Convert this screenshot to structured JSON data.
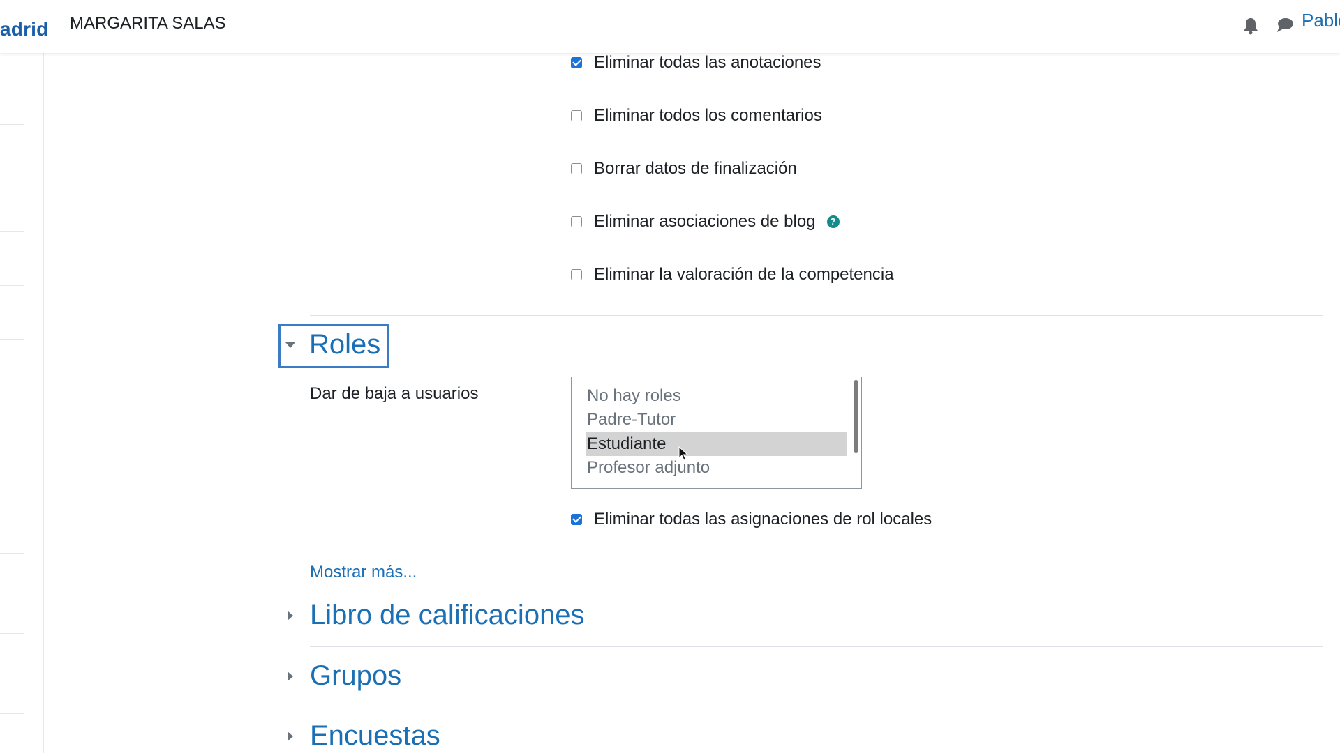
{
  "navbar": {
    "brand": "adrid",
    "site_name": "MARGARITA SALAS",
    "user_name": "Pablo",
    "notifications_icon": "bell-icon",
    "messages_icon": "chat-icon"
  },
  "checkboxes_top": [
    {
      "label": "Eliminar todas las anotaciones",
      "checked": true
    },
    {
      "label": "Eliminar todos los comentarios",
      "checked": false
    },
    {
      "label": "Borrar datos de finalización",
      "checked": false
    },
    {
      "label": "Eliminar asociaciones de blog",
      "checked": false,
      "help": "?"
    },
    {
      "label": "Eliminar la valoración de la competencia",
      "checked": false
    }
  ],
  "roles": {
    "title": "Roles",
    "unenrol_label": "Dar de baja a usuarios",
    "options": [
      "No hay roles",
      "Padre-Tutor",
      "Estudiante",
      "Profesor adjunto"
    ],
    "selected": "Estudiante",
    "remove_local_roles": {
      "label": "Eliminar todas las asignaciones de rol locales",
      "checked": true
    },
    "show_more": "Mostrar más..."
  },
  "sections": [
    {
      "title": "Libro de calificaciones",
      "expanded": false
    },
    {
      "title": "Grupos",
      "expanded": false
    },
    {
      "title": "Encuestas",
      "expanded": false
    }
  ],
  "colors": {
    "link": "#1a6fb5",
    "checkbox_checked": "#1a73d9",
    "focus_outline": "#3b7cc4",
    "help_icon": "#148a8a"
  }
}
